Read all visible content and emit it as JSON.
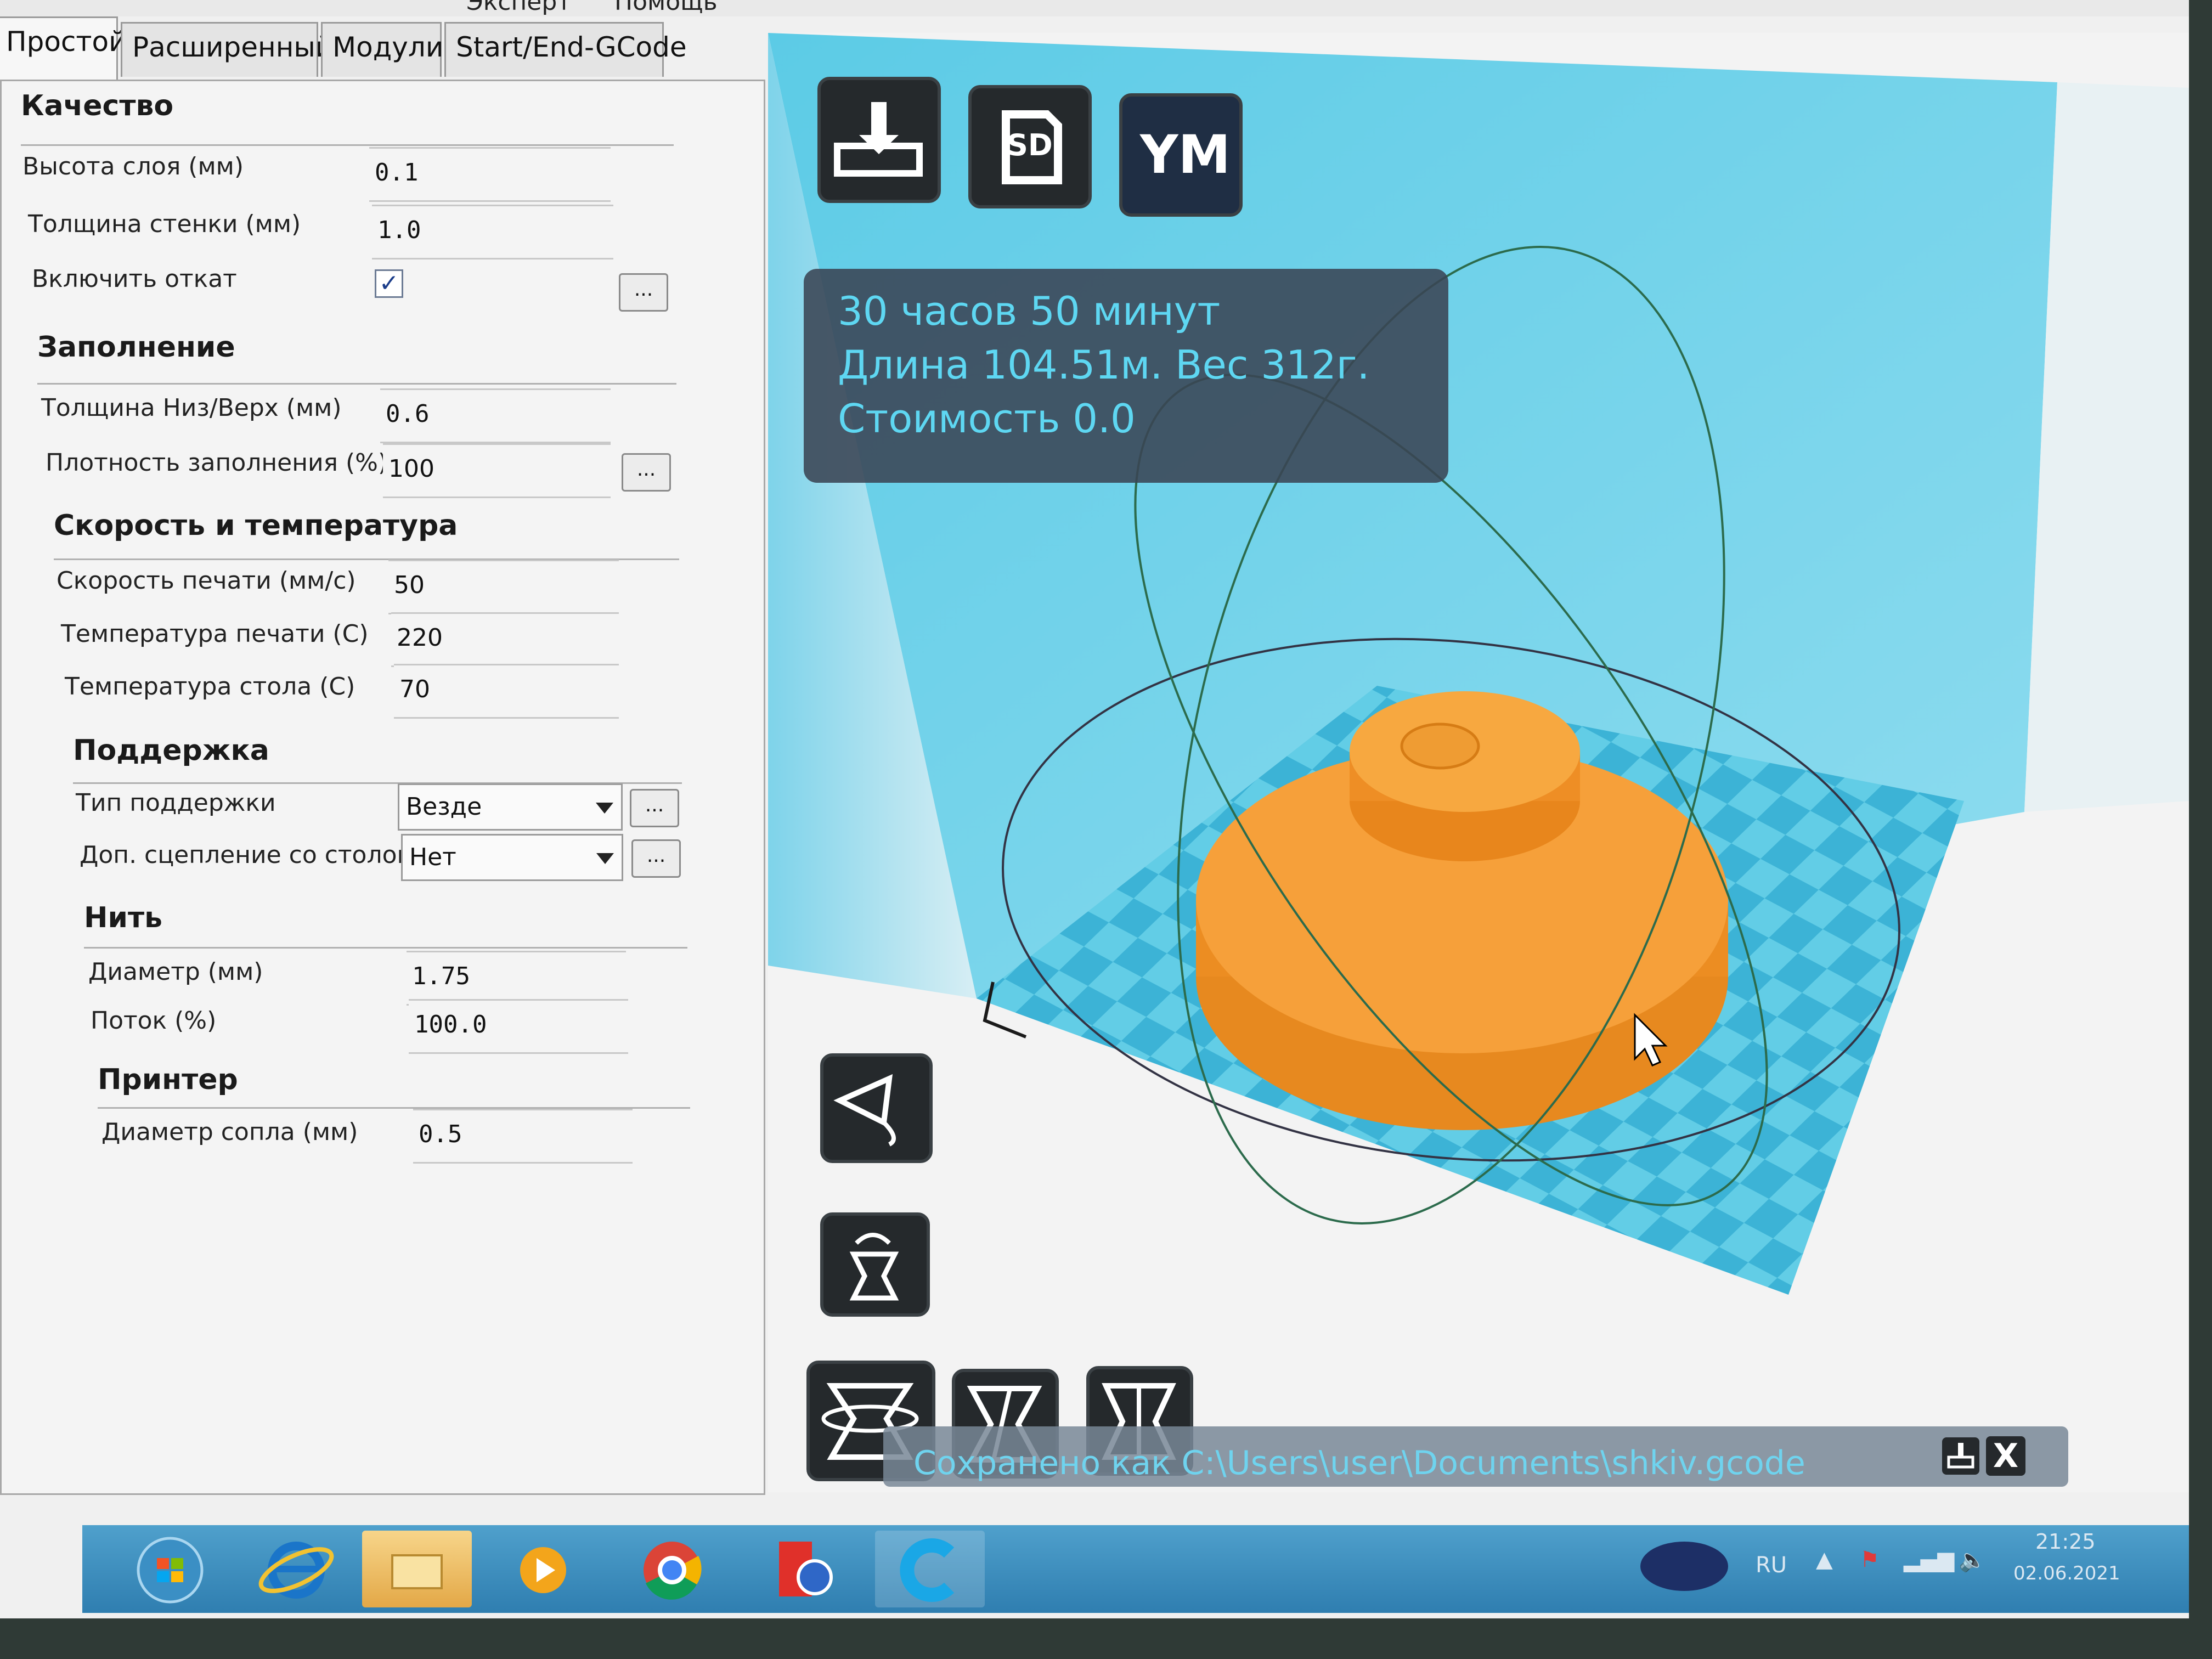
{
  "menu": {
    "items": [
      "Эксперт",
      "Помощь"
    ]
  },
  "tabs": [
    {
      "label": "Простой",
      "active": true
    },
    {
      "label": "Расширенный",
      "active": false
    },
    {
      "label": "Модули",
      "active": false
    },
    {
      "label": "Start/End-GCode",
      "active": false
    }
  ],
  "quality": {
    "title": "Качество",
    "layer_height_label": "Высота слоя (мм)",
    "layer_height_value": "0.1",
    "wall_thickness_label": "Толщина стенки (мм)",
    "wall_thickness_value": "1.0",
    "retraction_label": "Включить откат",
    "retraction_checked": true,
    "check_glyph": "✓"
  },
  "fill": {
    "title": "Заполнение",
    "bottom_top_label": "Толщина Низ/Верх (мм)",
    "bottom_top_value": "0.6",
    "density_label": "Плотность заполнения (%)",
    "density_value": "100"
  },
  "speed": {
    "title": "Скорость и температура",
    "print_speed_label": "Скорость печати (мм/с)",
    "print_speed_value": "50",
    "print_temp_label": "Температура печати (C)",
    "print_temp_value": "220",
    "bed_temp_label": "Температура стола (C)",
    "bed_temp_value": "70"
  },
  "support": {
    "title": "Поддержка",
    "type_label": "Тип поддержки",
    "type_value": "Везде",
    "adhesion_label": "Доп. сцепление со столом",
    "adhesion_value": "Нет"
  },
  "filament": {
    "title": "Нить",
    "diameter_label": "Диаметр (мм)",
    "diameter_value": "1.75",
    "flow_label": "Поток (%)",
    "flow_value": "100.0"
  },
  "printer": {
    "title": "Принтер",
    "nozzle_label": "Диаметр сопла (мм)",
    "nozzle_value": "0.5"
  },
  "more_label": "...",
  "viewport": {
    "top_buttons": {
      "sd_label": "SD",
      "ym_label": "YM"
    },
    "info": {
      "time": "30 часов 50 минут",
      "length_weight": "Длина 104.51м. Вес 312г.",
      "cost": "Стоимость 0.0"
    },
    "status_text": "Сохранено как C:\\Users\\user\\Documents\\shkiv.gcode",
    "close_label": "X"
  },
  "colors": {
    "model": "#f0932a",
    "bed_light": "#62cde6",
    "bed_dark": "#3cb3d6",
    "accent_text": "#5ed7f2"
  },
  "taskbar": {
    "icons": [
      "start-orb-icon",
      "internet-explorer-icon",
      "file-explorer-icon",
      "media-player-icon",
      "chrome-icon",
      "settings-app-icon",
      "cura-icon"
    ],
    "lang": "RU",
    "time": "21:25",
    "date": "02.06.2021"
  }
}
